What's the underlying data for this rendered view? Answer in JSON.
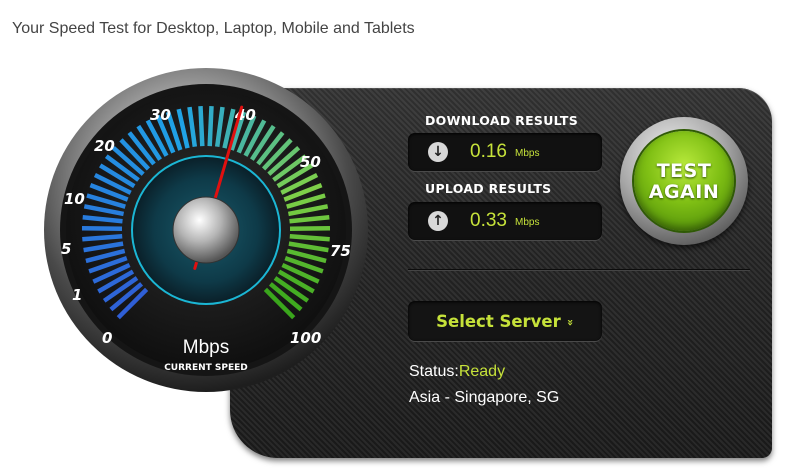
{
  "page": {
    "title": "Your Speed Test for Desktop, Laptop, Mobile and Tablets"
  },
  "gauge": {
    "unit": "Mbps",
    "caption": "CURRENT SPEED",
    "ticks": [
      "0",
      "1",
      "5",
      "10",
      "20",
      "30",
      "40",
      "50",
      "75",
      "100"
    ],
    "needle_fraction": 0.56,
    "colors": {
      "low": "#2f5fd6",
      "mid": "#1fa3e6",
      "high": "#7fd04a",
      "max": "#3aa61c"
    }
  },
  "download": {
    "label": "DOWNLOAD RESULTS",
    "value": "0.16",
    "unit": "Mbps",
    "icon": "arrow-down-icon"
  },
  "upload": {
    "label": "UPLOAD RESULTS",
    "value": "0.33",
    "unit": "Mbps",
    "icon": "arrow-up-icon"
  },
  "test_again": {
    "line1": "TEST",
    "line2": "AGAIN"
  },
  "server": {
    "select_label": "Select Server",
    "chevron": "»",
    "status_label": "Status:",
    "status_value": "Ready",
    "location": "Asia - Singapore, SG"
  },
  "colors": {
    "accent": "#c6e23a",
    "panel": "#2a2a2a",
    "button_green": "#7fbf14"
  }
}
